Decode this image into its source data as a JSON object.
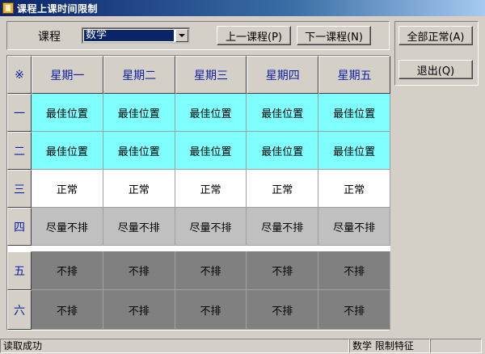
{
  "window": {
    "title": "课程上课时间限制"
  },
  "course": {
    "label": "课程",
    "selected": "数学"
  },
  "buttons": {
    "prev": "上一课程(P)",
    "next": "下一课程(N)",
    "all_normal": "全部正常(A)",
    "exit": "退出(Q)"
  },
  "grid": {
    "corner": "※",
    "days": [
      "星期一",
      "星期二",
      "星期三",
      "星期四",
      "星期五"
    ],
    "periods": [
      {
        "label": "一",
        "status": "best",
        "cells": [
          "最佳位置",
          "最佳位置",
          "最佳位置",
          "最佳位置",
          "最佳位置"
        ]
      },
      {
        "label": "二",
        "status": "best",
        "cells": [
          "最佳位置",
          "最佳位置",
          "最佳位置",
          "最佳位置",
          "最佳位置"
        ]
      },
      {
        "label": "三",
        "status": "normal",
        "cells": [
          "正常",
          "正常",
          "正常",
          "正常",
          "正常"
        ]
      },
      {
        "label": "四",
        "status": "avoid",
        "cells": [
          "尽量不排",
          "尽量不排",
          "尽量不排",
          "尽量不排",
          "尽量不排"
        ]
      },
      {
        "label": "五",
        "status": "no",
        "cells": [
          "不排",
          "不排",
          "不排",
          "不排",
          "不排"
        ]
      },
      {
        "label": "六",
        "status": "no",
        "cells": [
          "不排",
          "不排",
          "不排",
          "不排",
          "不排"
        ]
      }
    ]
  },
  "colors": {
    "best": "#80ffff",
    "normal": "#ffffff",
    "avoid": "#c0c0c0",
    "no": "#808080",
    "header_text": "#1020a0"
  },
  "status": {
    "message": "读取成功",
    "info": "数学 限制特征"
  }
}
